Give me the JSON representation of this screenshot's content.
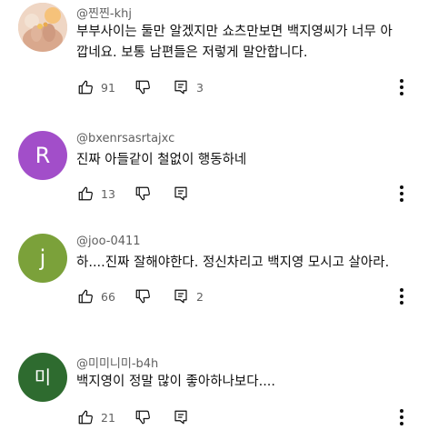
{
  "comments": [
    {
      "handle": "@찐찐-khj",
      "avatar": {
        "type": "photo",
        "icon": "profile-photo"
      },
      "text": "부부사이는 둘만 알겠지만 쇼츠만보면 백지영씨가 너무 아깝네요. 보통 남편들은 저렇게 말안합니다.",
      "likes": "91",
      "replies": "3"
    },
    {
      "handle": "@bxenrsasrtajxc",
      "avatar": {
        "type": "letter",
        "letter": "R",
        "color": "#a24ec9"
      },
      "text": "진짜 아들같이 철없이 행동하네",
      "likes": "13",
      "replies": ""
    },
    {
      "handle": "@joo-0411",
      "avatar": {
        "type": "letter",
        "letter": "j",
        "color": "#7ba13a"
      },
      "text": "하....진짜 잘해야한다. 정신차리고 백지영 모시고 살아라.",
      "likes": "66",
      "replies": "2"
    },
    {
      "handle": "@미미니미-b4h",
      "avatar": {
        "type": "letter",
        "letter": "미",
        "color": "#2e6b2f"
      },
      "text": "백지영이 정말 많이 좋아하나보다....",
      "likes": "21",
      "replies": ""
    }
  ],
  "icons": {
    "like": "thumbs-up-icon",
    "dislike": "thumbs-down-icon",
    "reply": "reply-icon",
    "more": "more-vertical-icon"
  }
}
